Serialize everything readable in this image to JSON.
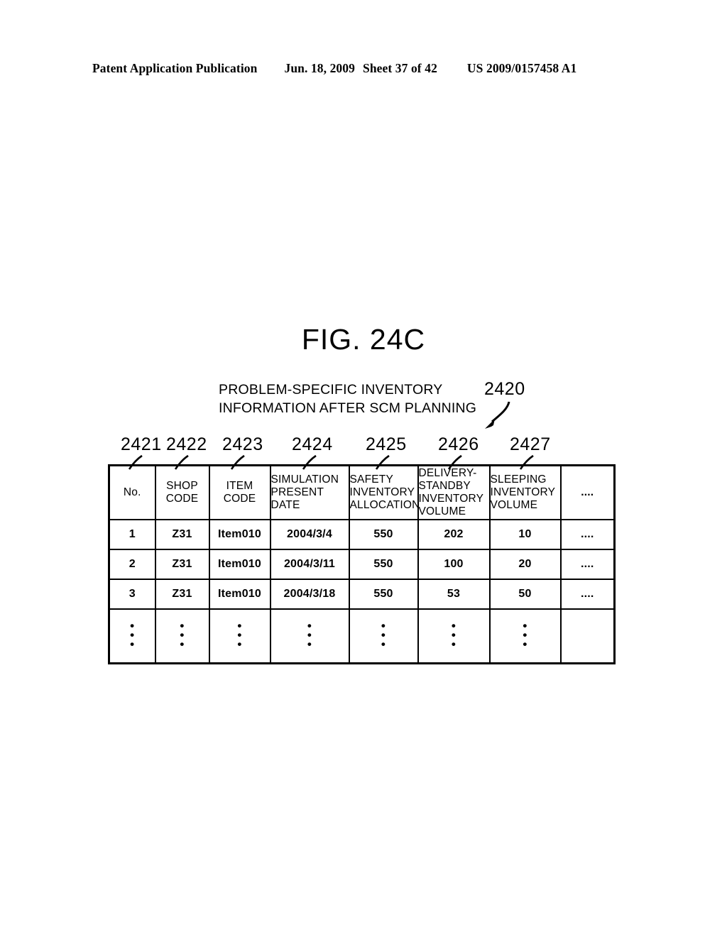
{
  "page_header": {
    "publication": "Patent Application Publication",
    "date": "Jun. 18, 2009",
    "sheet": "Sheet 37 of 42",
    "patent_number": "US 2009/0157458 A1"
  },
  "figure": {
    "title": "FIG. 24C",
    "caption_line1": "PROBLEM-SPECIFIC INVENTORY",
    "caption_line2": "INFORMATION AFTER SCM PLANNING",
    "table_ref": "2420"
  },
  "column_refs": [
    "2421",
    "2422",
    "2423",
    "2424",
    "2425",
    "2426",
    "2427"
  ],
  "table": {
    "headers": [
      "No.",
      "SHOP\nCODE",
      "ITEM\nCODE",
      "SIMULATION\nPRESENT\nDATE",
      "SAFETY\nINVENTORY\nALLOCATION",
      "DELIVERY-\nSTANDBY\nINVENTORY\nVOLUME",
      "SLEEPING\nINVENTORY\nVOLUME",
      "...."
    ],
    "header_no": "No.",
    "header_shop_l1": "SHOP",
    "header_shop_l2": "CODE",
    "header_item_l1": "ITEM",
    "header_item_l2": "CODE",
    "header_sim_l1": "SIMULATION",
    "header_sim_l2": "PRESENT",
    "header_sim_l3": "DATE",
    "header_safe_l1": "SAFETY",
    "header_safe_l2": "INVENTORY",
    "header_safe_l3": "ALLOCATION",
    "header_del_l1": "DELIVERY-",
    "header_del_l2": "STANDBY",
    "header_del_l3": "INVENTORY",
    "header_del_l4": "VOLUME",
    "header_sleep_l1": "SLEEPING",
    "header_sleep_l2": "INVENTORY",
    "header_sleep_l3": "VOLUME",
    "header_rest": "....",
    "rows": [
      {
        "no": "1",
        "shop_code": "Z31",
        "item_code": "Item010",
        "simulation_present_date": "2004/3/4",
        "safety_inventory_allocation": "550",
        "delivery_standby_inventory_volume": "202",
        "sleeping_inventory_volume": "10",
        "rest": "...."
      },
      {
        "no": "2",
        "shop_code": "Z31",
        "item_code": "Item010",
        "simulation_present_date": "2004/3/11",
        "safety_inventory_allocation": "550",
        "delivery_standby_inventory_volume": "100",
        "sleeping_inventory_volume": "20",
        "rest": "...."
      },
      {
        "no": "3",
        "shop_code": "Z31",
        "item_code": "Item010",
        "simulation_present_date": "2004/3/18",
        "safety_inventory_allocation": "550",
        "delivery_standby_inventory_volume": "53",
        "sleeping_inventory_volume": "50",
        "rest": "...."
      }
    ],
    "continuation_dot": "•",
    "continuation_row_last_cell": ""
  }
}
